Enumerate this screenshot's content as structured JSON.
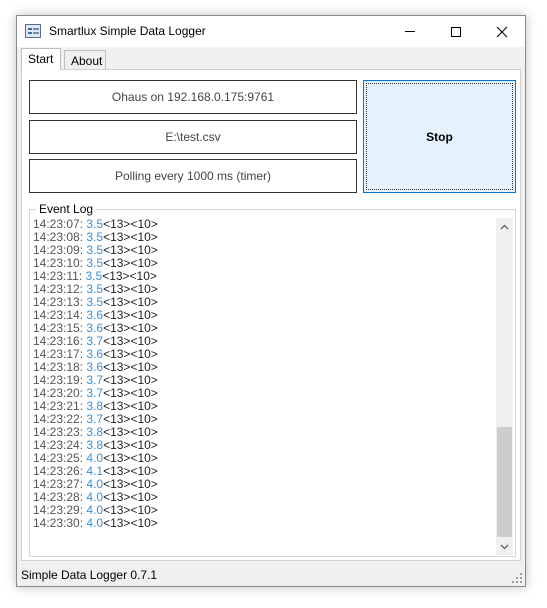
{
  "window": {
    "title": "Smartlux Simple Data Logger",
    "controls": {
      "minimize": "minimize",
      "maximize": "maximize",
      "close": "close"
    }
  },
  "tabs": [
    {
      "label": "Start",
      "active": true
    },
    {
      "label": "About",
      "active": false
    }
  ],
  "info": {
    "connection": "Ohaus on 192.168.0.175:9761",
    "file": "E:\\test.csv",
    "polling": "Polling every 1000 ms (timer)"
  },
  "stop_label": "Stop",
  "event_log": {
    "label": "Event Log",
    "entries": [
      {
        "time": "14:23:07:",
        "value": "3.5",
        "tail": "<13><10>"
      },
      {
        "time": "14:23:08:",
        "value": "3.5",
        "tail": "<13><10>"
      },
      {
        "time": "14:23:09:",
        "value": "3.5",
        "tail": "<13><10>"
      },
      {
        "time": "14:23:10:",
        "value": "3.5",
        "tail": "<13><10>"
      },
      {
        "time": "14:23:11:",
        "value": "3.5",
        "tail": "<13><10>"
      },
      {
        "time": "14:23:12:",
        "value": "3.5",
        "tail": "<13><10>"
      },
      {
        "time": "14:23:13:",
        "value": "3.5",
        "tail": "<13><10>"
      },
      {
        "time": "14:23:14:",
        "value": "3.6",
        "tail": "<13><10>"
      },
      {
        "time": "14:23:15:",
        "value": "3.6",
        "tail": "<13><10>"
      },
      {
        "time": "14:23:16:",
        "value": "3.7",
        "tail": "<13><10>"
      },
      {
        "time": "14:23:17:",
        "value": "3.6",
        "tail": "<13><10>"
      },
      {
        "time": "14:23:18:",
        "value": "3.6",
        "tail": "<13><10>"
      },
      {
        "time": "14:23:19:",
        "value": "3.7",
        "tail": "<13><10>"
      },
      {
        "time": "14:23:20:",
        "value": "3.7",
        "tail": "<13><10>"
      },
      {
        "time": "14:23:21:",
        "value": "3.8",
        "tail": "<13><10>"
      },
      {
        "time": "14:23:22:",
        "value": "3.7",
        "tail": "<13><10>"
      },
      {
        "time": "14:23:23:",
        "value": "3.8",
        "tail": "<13><10>"
      },
      {
        "time": "14:23:24:",
        "value": "3.8",
        "tail": "<13><10>"
      },
      {
        "time": "14:23:25:",
        "value": "4.0",
        "tail": "<13><10>"
      },
      {
        "time": "14:23:26:",
        "value": "4.1",
        "tail": "<13><10>"
      },
      {
        "time": "14:23:27:",
        "value": "4.0",
        "tail": "<13><10>"
      },
      {
        "time": "14:23:28:",
        "value": "4.0",
        "tail": "<13><10>"
      },
      {
        "time": "14:23:29:",
        "value": "4.0",
        "tail": "<13><10>"
      },
      {
        "time": "14:23:30:",
        "value": "4.0",
        "tail": "<13><10>"
      }
    ]
  },
  "status": {
    "text": "Simple Data Logger 0.7.1"
  },
  "colors": {
    "value_text": "#3b8fd6",
    "stop_bg": "#e5f1fb",
    "stop_border": "#0078d7"
  }
}
